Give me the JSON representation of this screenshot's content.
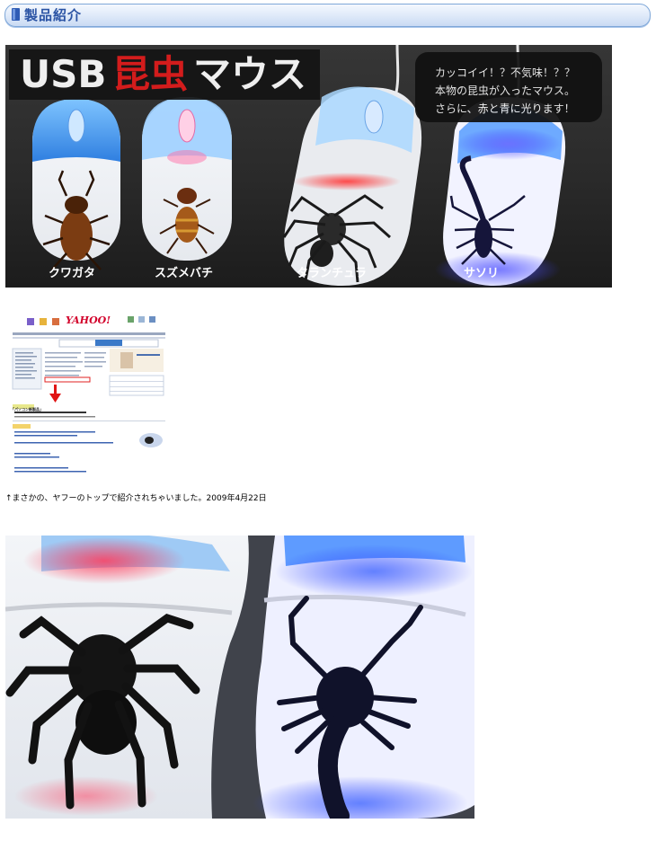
{
  "header": {
    "title": "製品紹介",
    "icon": "square-bullet-icon",
    "accent": "#2a53a4"
  },
  "banner": {
    "logo": {
      "usb": "USB",
      "kanji": "昆虫",
      "mouse": "マウス"
    },
    "bubble_lines": [
      "カッコイイ！？不気味！？？",
      "本物の昆虫が入ったマウス。",
      "さらに、赤と青に光ります！"
    ],
    "product_labels": [
      "クワガタ",
      "スズメバチ",
      "タランチュラ",
      "サソリ"
    ]
  },
  "yahoo": {
    "logo": "YAHOO!",
    "headline": "「パソコン新製品」"
  },
  "caption": "↑まさかの、ヤフーのトップで紹介されちゃいました。2009年4月22日"
}
